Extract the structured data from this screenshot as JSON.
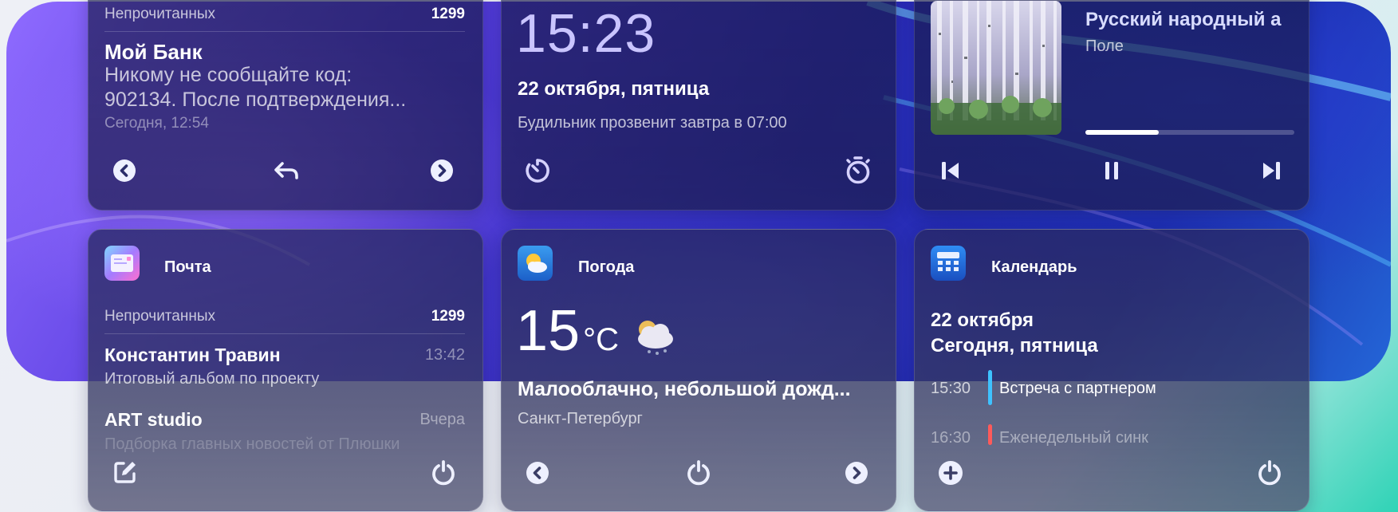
{
  "mail_top": {
    "unread_label": "Непрочитанных",
    "unread_count": "1299",
    "sender": "Мой Банк",
    "message_line1": "Никому не сообщайте код:",
    "message_line2": "902134. После подтверждения...",
    "time": "Сегодня, 12:54"
  },
  "clock": {
    "time": "15:23",
    "date": "22 октября, пятница",
    "alarm": "Будильник прозвенит завтра в 07:00"
  },
  "music": {
    "title": "Русский народный а",
    "artist": "Поле",
    "progress": 0.35
  },
  "mail": {
    "app_name": "Почта",
    "unread_label": "Непрочитанных",
    "unread_count": "1299",
    "messages": [
      {
        "sender": "Константин Травин",
        "time": "13:42",
        "subject": "Итоговый альбом по проекту"
      },
      {
        "sender": "ART studio",
        "time": "Вчера",
        "subject": "Подборка главных новостей от Плюшки"
      }
    ]
  },
  "weather": {
    "app_name": "Погода",
    "temperature": "15",
    "unit": "°C",
    "condition": "Малооблачно, небольшой дожд...",
    "city": "Санкт-Петербург"
  },
  "calendar": {
    "app_name": "Календарь",
    "date": "22 октября",
    "day": "Сегодня, пятница",
    "events": [
      {
        "time": "15:30",
        "title": "Встреча с партнером",
        "color": "#3ec2ff"
      },
      {
        "time": "16:30",
        "title": "Еженедельный синк",
        "color": "#ff5a5a"
      }
    ]
  },
  "icons": {
    "prev": "chevron-left-circle-icon",
    "reply": "reply-icon",
    "next": "chevron-right-circle-icon",
    "timer": "timer-icon",
    "stopwatch": "stopwatch-icon",
    "skip_back": "skip-back-icon",
    "pause": "pause-icon",
    "skip_forward": "skip-forward-icon",
    "compose": "compose-icon",
    "refresh": "refresh-icon",
    "add": "add-circle-icon"
  }
}
